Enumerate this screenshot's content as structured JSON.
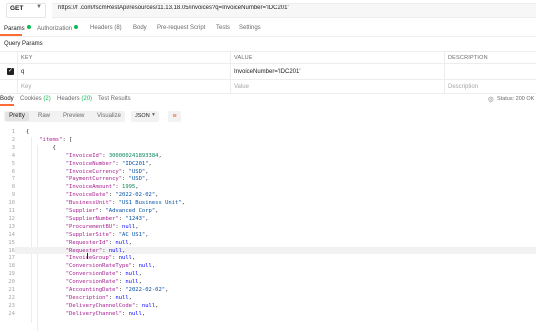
{
  "request": {
    "method": "GET",
    "url": "https://f                                           .com/fscmRestApi/resources/11.13.18.05/invoices?q=InvoiceNumber='IDC201'"
  },
  "request_tabs": [
    {
      "label": "Params",
      "dot": true
    },
    {
      "label": "Authorization",
      "dot": true
    },
    {
      "label": "Headers (8)"
    },
    {
      "label": "Body"
    },
    {
      "label": "Pre-request Script"
    },
    {
      "label": "Tests"
    },
    {
      "label": "Settings"
    }
  ],
  "query_params": {
    "title": "Query Params",
    "columns": [
      "KEY",
      "VALUE",
      "DESCRIPTION"
    ],
    "rows": [
      {
        "key": "q",
        "value": "InvoiceNumber='IDC201'",
        "description": "",
        "checked": true
      }
    ],
    "placeholders": {
      "key": "Key",
      "value": "Value",
      "description": "Description"
    }
  },
  "response_tabs": {
    "body": "Body",
    "cookies_label": "Cookies",
    "cookies_count": "(2)",
    "headers_label": "Headers",
    "headers_count": "(20)",
    "test_results": "Test Results"
  },
  "status": {
    "icon": "globe-icon",
    "text": "Status: 200 OK"
  },
  "view": {
    "buttons": [
      "Pretty",
      "Raw",
      "Preview",
      "Visualize"
    ],
    "format": "JSON",
    "wrap_icon": "wrap-lines-icon"
  },
  "code_lines": [
    [
      [
        "p",
        "{"
      ]
    ],
    [
      [
        "p",
        "    "
      ],
      [
        "k",
        "\"items\""
      ],
      [
        "p",
        ": ["
      ]
    ],
    [
      [
        "p",
        "        {"
      ]
    ],
    [
      [
        "p",
        "            "
      ],
      [
        "k",
        "\"InvoiceId\""
      ],
      [
        "p",
        ": "
      ],
      [
        "n",
        "300000241893384"
      ],
      [
        "p",
        ","
      ]
    ],
    [
      [
        "p",
        "            "
      ],
      [
        "k",
        "\"InvoiceNumber\""
      ],
      [
        "p",
        ": "
      ],
      [
        "s",
        "\"IDC201\""
      ],
      [
        "p",
        ","
      ]
    ],
    [
      [
        "p",
        "            "
      ],
      [
        "k",
        "\"InvoiceCurrency\""
      ],
      [
        "p",
        ": "
      ],
      [
        "s",
        "\"USD\""
      ],
      [
        "p",
        ","
      ]
    ],
    [
      [
        "p",
        "            "
      ],
      [
        "k",
        "\"PaymentCurrency\""
      ],
      [
        "p",
        ": "
      ],
      [
        "s",
        "\"USD\""
      ],
      [
        "p",
        ","
      ]
    ],
    [
      [
        "p",
        "            "
      ],
      [
        "k",
        "\"InvoiceAmount\""
      ],
      [
        "p",
        ": "
      ],
      [
        "n",
        "1995"
      ],
      [
        "p",
        ","
      ]
    ],
    [
      [
        "p",
        "            "
      ],
      [
        "k",
        "\"InvoiceDate\""
      ],
      [
        "p",
        ": "
      ],
      [
        "s",
        "\"2022-02-02\""
      ],
      [
        "p",
        ","
      ]
    ],
    [
      [
        "p",
        "            "
      ],
      [
        "k",
        "\"BusinessUnit\""
      ],
      [
        "p",
        ": "
      ],
      [
        "s",
        "\"US1 Business Unit\""
      ],
      [
        "p",
        ","
      ]
    ],
    [
      [
        "p",
        "            "
      ],
      [
        "k",
        "\"Supplier\""
      ],
      [
        "p",
        ": "
      ],
      [
        "s",
        "\"Advanced Corp\""
      ],
      [
        "p",
        ","
      ]
    ],
    [
      [
        "p",
        "            "
      ],
      [
        "k",
        "\"SupplierNumber\""
      ],
      [
        "p",
        ": "
      ],
      [
        "s",
        "\"1243\""
      ],
      [
        "p",
        ","
      ]
    ],
    [
      [
        "p",
        "            "
      ],
      [
        "k",
        "\"ProcurementBU\""
      ],
      [
        "p",
        ": "
      ],
      [
        "nl",
        "null"
      ],
      [
        "p",
        ","
      ]
    ],
    [
      [
        "p",
        "            "
      ],
      [
        "k",
        "\"SupplierSite\""
      ],
      [
        "p",
        ": "
      ],
      [
        "s",
        "\"AC US1\""
      ],
      [
        "p",
        ","
      ]
    ],
    [
      [
        "p",
        "            "
      ],
      [
        "k",
        "\"RequesterId\""
      ],
      [
        "p",
        ": "
      ],
      [
        "nl",
        "null"
      ],
      [
        "p",
        ","
      ]
    ],
    [
      [
        "p",
        "            "
      ],
      [
        "k",
        "\"Requester\""
      ],
      [
        "p",
        ": "
      ],
      [
        "nl",
        "null"
      ],
      [
        "p",
        ","
      ]
    ],
    [
      [
        "p",
        "            "
      ],
      [
        "k",
        "\"InvoiceGroup\""
      ],
      [
        "p",
        ": "
      ],
      [
        "nl",
        "null"
      ],
      [
        "p",
        ","
      ]
    ],
    [
      [
        "p",
        "            "
      ],
      [
        "k",
        "\"ConversionRateType\""
      ],
      [
        "p",
        ": "
      ],
      [
        "nl",
        "null"
      ],
      [
        "p",
        ","
      ]
    ],
    [
      [
        "p",
        "            "
      ],
      [
        "k",
        "\"ConversionDate\""
      ],
      [
        "p",
        ": "
      ],
      [
        "nl",
        "null"
      ],
      [
        "p",
        ","
      ]
    ],
    [
      [
        "p",
        "            "
      ],
      [
        "k",
        "\"ConversionRate\""
      ],
      [
        "p",
        ": "
      ],
      [
        "nl",
        "null"
      ],
      [
        "p",
        ","
      ]
    ],
    [
      [
        "p",
        "            "
      ],
      [
        "k",
        "\"AccountingDate\""
      ],
      [
        "p",
        ": "
      ],
      [
        "s",
        "\"2022-02-02\""
      ],
      [
        "p",
        ","
      ]
    ],
    [
      [
        "p",
        "            "
      ],
      [
        "k",
        "\"Description\""
      ],
      [
        "p",
        ": "
      ],
      [
        "nl",
        "null"
      ],
      [
        "p",
        ","
      ]
    ],
    [
      [
        "p",
        "            "
      ],
      [
        "k",
        "\"DeliveryChannelCode\""
      ],
      [
        "p",
        ": "
      ],
      [
        "nl",
        "null"
      ],
      [
        "p",
        ","
      ]
    ],
    [
      [
        "p",
        "            "
      ],
      [
        "k",
        "\"DeliveryChannel\""
      ],
      [
        "p",
        ": "
      ],
      [
        "nl",
        "null"
      ],
      [
        "p",
        ","
      ]
    ]
  ]
}
